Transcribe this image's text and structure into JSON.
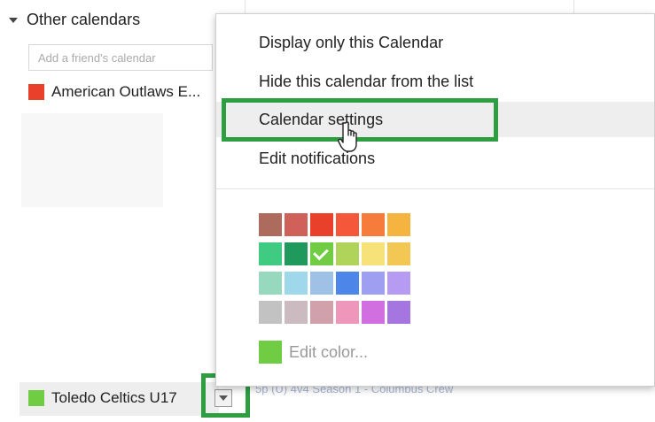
{
  "sidebar": {
    "section_title": "Other calendars",
    "friend_input_placeholder": "Add a friend's calendar",
    "calendars": [
      {
        "label": "American Outlaws E...",
        "color": "#e8402b"
      },
      {
        "label": "Toledo Celtics U17",
        "color": "#6fcc43"
      }
    ]
  },
  "popup_menu": {
    "items": [
      {
        "label": "Display only this Calendar"
      },
      {
        "label": "Hide this calendar from the list"
      },
      {
        "label": "Calendar settings",
        "highlighted": true
      },
      {
        "label": "Edit notifications"
      }
    ],
    "palette": [
      [
        "#ad6b5d",
        "#d0605a",
        "#e8402b",
        "#f5573a",
        "#f57c3a",
        "#f5b340"
      ],
      [
        "#3fcb82",
        "#1f9a5c",
        "#6fcc43",
        "#b0d35a",
        "#f7e27a",
        "#f3c753"
      ],
      [
        "#96d9bf",
        "#9ed8ea",
        "#a0c1e6",
        "#4b86e8",
        "#9f9ff2",
        "#b79af2"
      ],
      [
        "#c2c2c2",
        "#cbbac0",
        "#d0a1aa",
        "#ef97bb",
        "#d16fe0",
        "#a676e0"
      ]
    ],
    "selected_color": "#6fcc43",
    "edit_color_label": "Edit color...",
    "edit_color_swatch": "#6fcc43"
  },
  "background": {
    "event_text": "5p (U) 4v4 Season 1 - Columbus Crew"
  },
  "accent_highlight": "#2e9e43"
}
